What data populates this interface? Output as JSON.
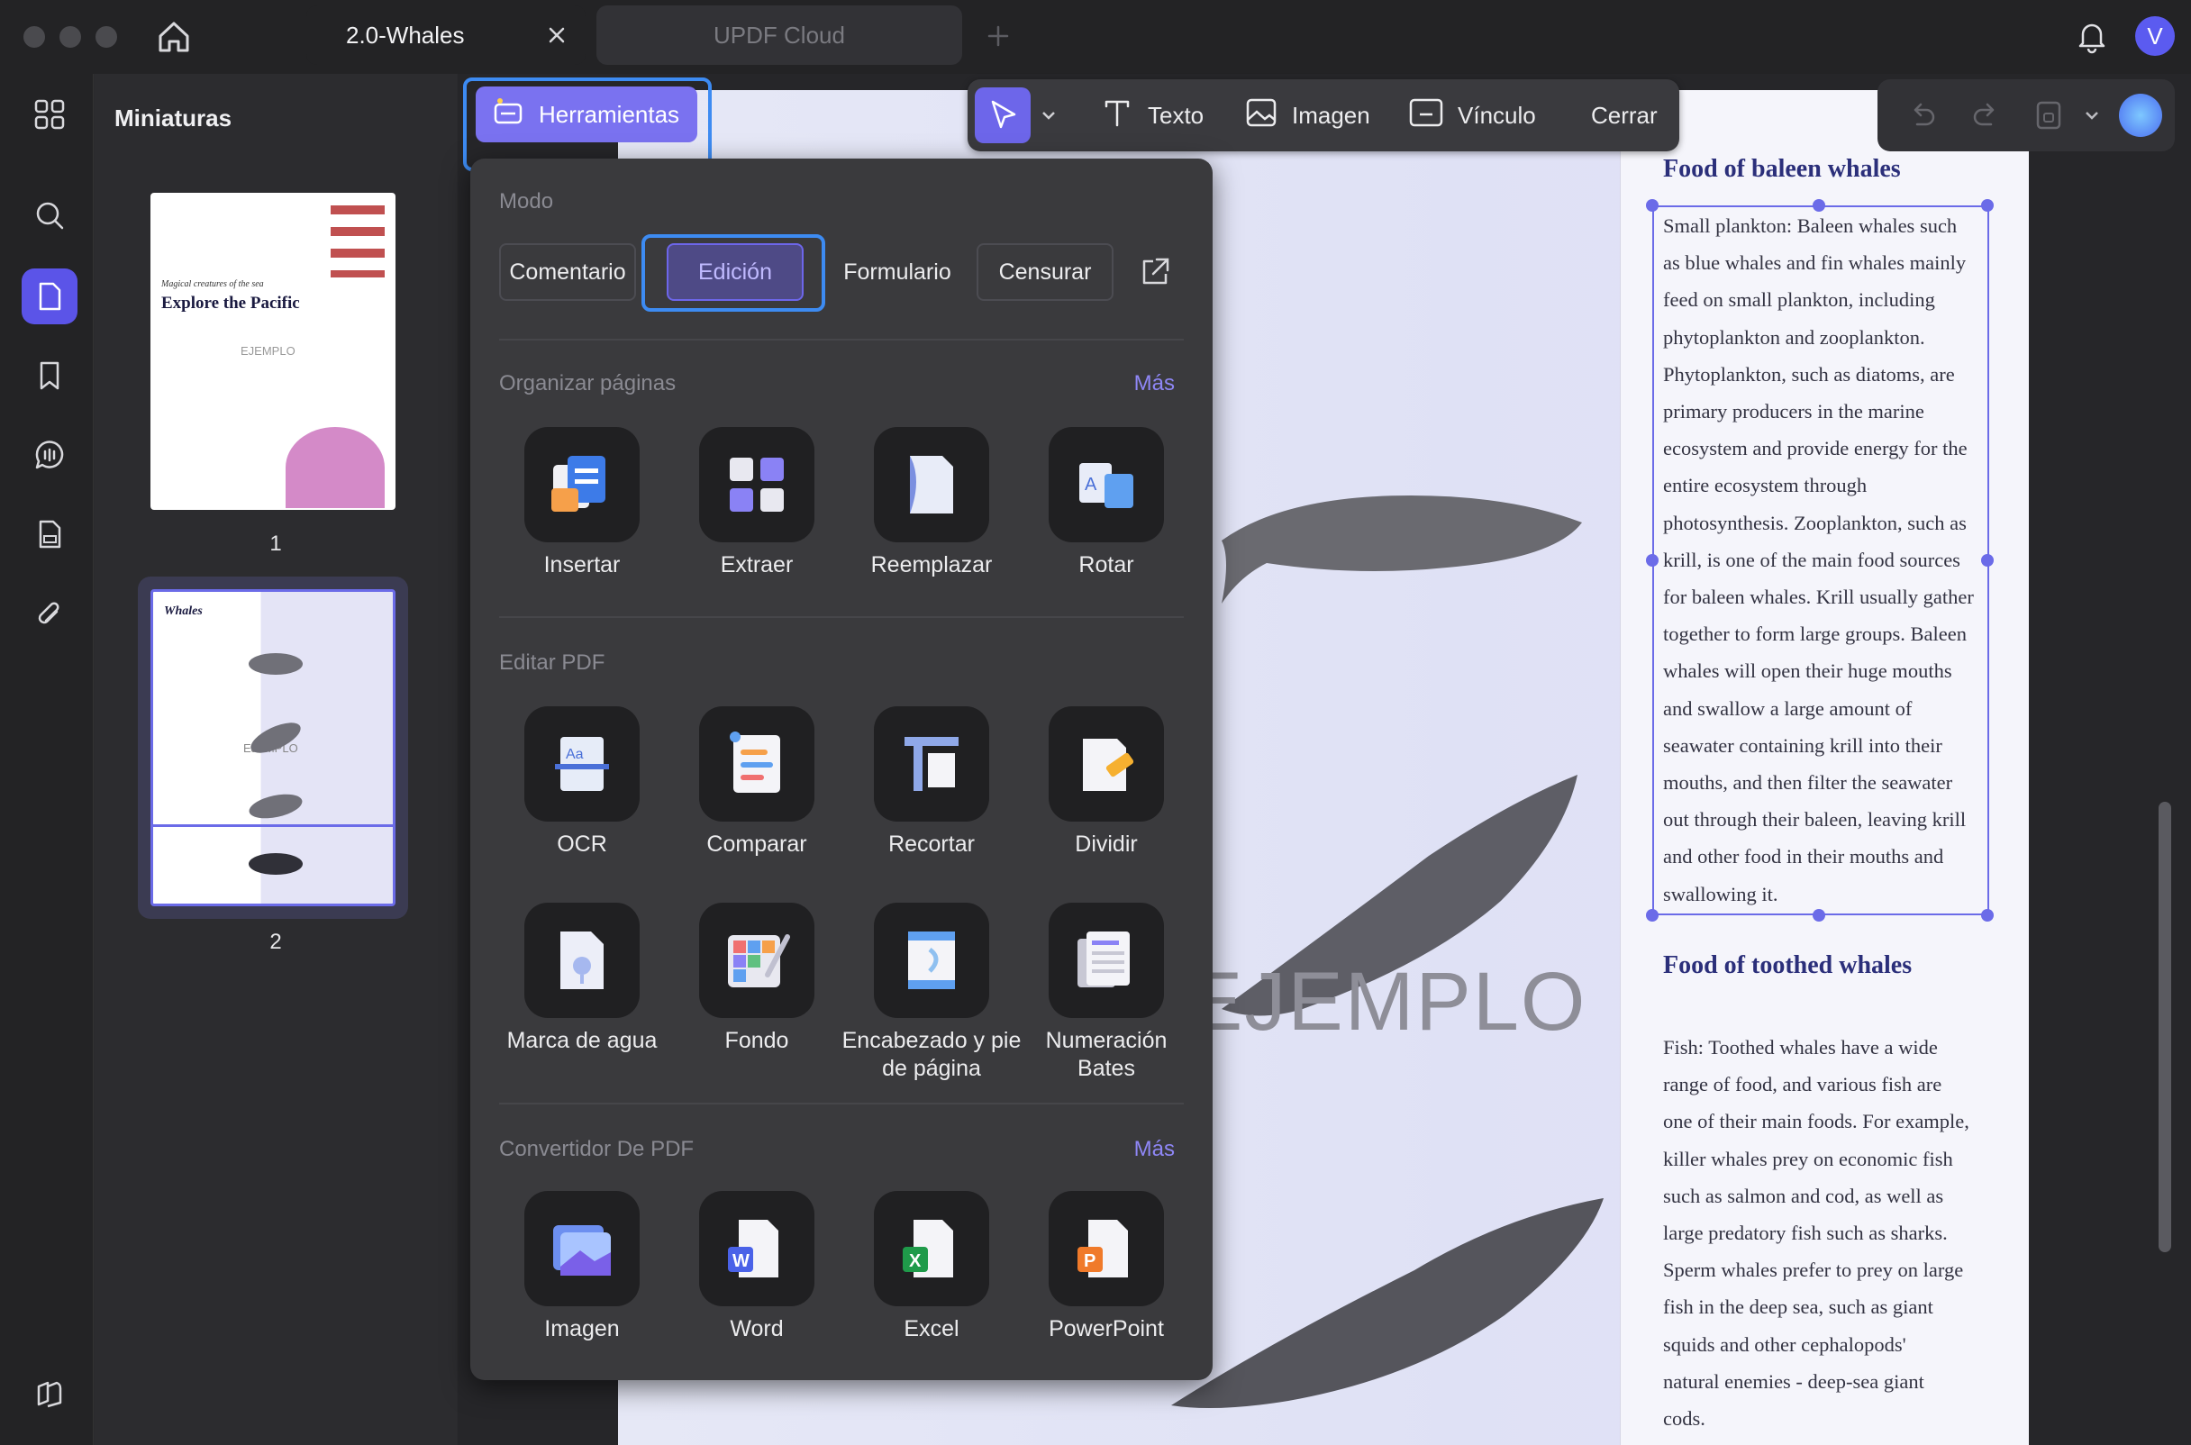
{
  "titlebar": {
    "tab_active": "2.0-Whales",
    "tab_cloud": "UPDF Cloud",
    "avatar_letter": "V"
  },
  "icons": {
    "home": "home-icon",
    "close": "close-icon",
    "plus": "plus-icon",
    "bell": "bell-icon",
    "rail": [
      "grid-icon",
      "search-icon",
      "document-icon",
      "bookmark-icon",
      "comment-icon",
      "form-icon",
      "paperclip-icon",
      "layers-icon"
    ]
  },
  "thumbnails": {
    "title": "Miniaturas",
    "pages": [
      {
        "num": "1",
        "heading": "Explore the Pacific",
        "subheading": "Magical creatures of the sea",
        "watermark": "EJEMPLO"
      },
      {
        "num": "2",
        "heading": "Whales",
        "watermark": "EJEMPLO"
      }
    ]
  },
  "toolbar": {
    "herramientas": "Herramientas",
    "texto": "Texto",
    "imagen": "Imagen",
    "vinculo": "Vínculo",
    "cerrar": "Cerrar"
  },
  "panel": {
    "modo_title": "Modo",
    "modes": [
      "Comentario",
      "Edición",
      "Formulario",
      "Censurar"
    ],
    "organizar_title": "Organizar páginas",
    "mas": "Más",
    "organizar": [
      "Insertar",
      "Extraer",
      "Reemplazar",
      "Rotar"
    ],
    "editar_title": "Editar PDF",
    "editar_row1": [
      "OCR",
      "Comparar",
      "Recortar",
      "Dividir"
    ],
    "editar_row2": [
      "Marca de agua",
      "Fondo",
      "Encabezado y pie de página",
      "Numeración Bates"
    ],
    "convertidor_title": "Convertidor De PDF",
    "convertidor": [
      "Imagen",
      "Word",
      "Excel",
      "PowerPoint"
    ]
  },
  "document": {
    "heading1": "Food of baleen whales",
    "paragraph1": [
      "Small plankton: Baleen whales such",
      "as blue whales and fin whales mainly",
      "feed on small plankton, including",
      "phytoplankton and zooplankton.",
      "Phytoplankton, such as diatoms, are",
      "primary producers in the marine",
      "ecosystem and provide energy for the",
      "entire ecosystem through",
      "photosynthesis. Zooplankton, such as",
      "krill, is one of the main food sources",
      "for baleen whales. Krill usually gather",
      "together to form large groups. Baleen",
      "whales will open their huge mouths",
      "and swallow a large amount of",
      "seawater containing krill into their",
      "mouths, and then filter the seawater",
      "out through their baleen, leaving krill",
      "and other food in their mouths and",
      "swallowing it."
    ],
    "heading2": "Food of toothed whales",
    "paragraph2": [
      "Fish: Toothed whales have a wide",
      "range of food, and various fish are",
      "one of their main foods. For example,",
      "killer whales prey on economic fish",
      "such as salmon and cod, as well as",
      "large predatory fish such as sharks.",
      "Sperm whales prefer to prey on large",
      "fish in the deep sea, such as giant",
      "squids and other cephalopods'",
      "natural enemies - deep-sea giant",
      "cods."
    ],
    "watermark": "EJEMPLO"
  }
}
